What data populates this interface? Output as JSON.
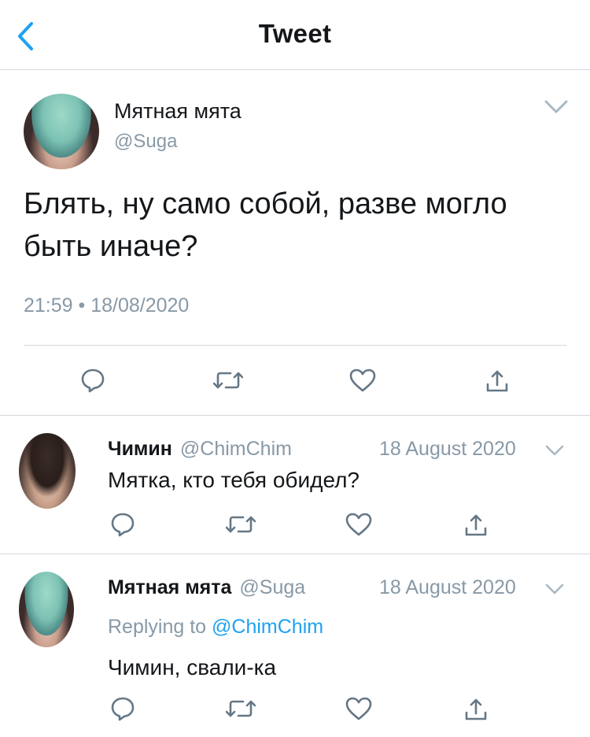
{
  "header": {
    "title": "Tweet"
  },
  "main_tweet": {
    "author_name": "Мятная мята",
    "author_handle": "@Suga",
    "text": "Блять, ну само собой, разве могло быть иначе?",
    "timestamp": "21:59 • 18/08/2020"
  },
  "replies": [
    {
      "author_name": "Чимин",
      "author_handle": "@ChimChim",
      "date": "18 August 2020",
      "text": "Мятка, кто тебя обидел?"
    },
    {
      "author_name": "Мятная мята",
      "author_handle": "@Suga",
      "date": "18 August 2020",
      "replying_prefix": "Replying to",
      "replying_to": "@ChimChim",
      "text": "Чимин, свали-ка"
    }
  ],
  "icons": {
    "back": "chevron-left-icon",
    "more": "chevron-down-icon",
    "reply": "comment-icon",
    "retweet": "retweet-icon",
    "like": "heart-icon",
    "share": "share-icon"
  },
  "colors": {
    "accent": "#1da1f2",
    "secondary_text": "#8899a6",
    "icon": "#657786",
    "divider": "#d5d8dc"
  }
}
